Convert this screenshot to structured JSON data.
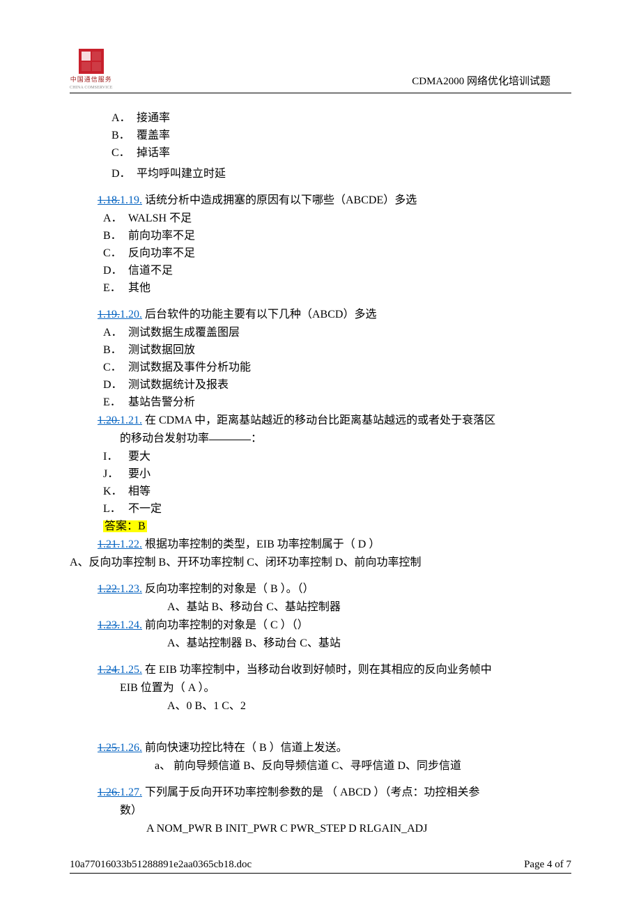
{
  "header": {
    "logo_cn": "中国通信服务",
    "logo_en": "CHINA COMSERVICE",
    "title": "CDMA2000 网络优化培训试题"
  },
  "intro_opts": {
    "a": "接通率",
    "b": "覆盖率",
    "c": "掉话率",
    "d": "平均呼叫建立时延"
  },
  "q119": {
    "num_old": "1.18.",
    "num_new": "1.19.",
    "text": " 话统分析中造成拥塞的原因有以下哪些（ABCDE）多选",
    "a": "WALSH 不足",
    "b": "前向功率不足",
    "c": "反向功率不足",
    "d": "信道不足",
    "e": "其他"
  },
  "q120": {
    "num_old": "1.19.",
    "num_new": "1.20.",
    "text": " 后台软件的功能主要有以下几种（ABCD）多选",
    "a": "测试数据生成覆盖图层",
    "b": "测试数据回放",
    "c": "测试数据及事件分析功能",
    "d": "测试数据统计及报表",
    "e": "基站告警分析"
  },
  "q121": {
    "num_old": "1.20.",
    "num_new": "1.21.",
    "text1": " 在 CDMA 中，距离基站越近的移动台比距离基站越远的或者处于衰落区",
    "text2": "的移动台发射功率",
    "i": "要大",
    "j": "要小",
    "k": "相等",
    "l": "不一定",
    "answer": "答案：B"
  },
  "q122": {
    "num_old": "1.21.",
    "num_new": "1.22.",
    "text": " 根据功率控制的类型，EIB 功率控制属于（ D ）",
    "opts": "A、反向功率控制 B、开环功率控制 C、闭环功率控制 D、前向功率控制"
  },
  "q123": {
    "num_old": "1.22.",
    "num_new": "1.23.",
    "text": " 反向功率控制的对象是（ B ）。（）",
    "opts": "A、基站 B、移动台 C、基站控制器"
  },
  "q124": {
    "num_old": "1.23.",
    "num_new": "1.24.",
    "text": " 前向功率控制的对象是（ C ）（）",
    "opts": "A、基站控制器 B、移动台 C、基站"
  },
  "q125": {
    "num_old": "1.24.",
    "num_new": "1.25.",
    "text": " 在 EIB 功率控制中，当移动台收到好帧时，则在其相应的反向业务帧中",
    "text2": "EIB 位置为（ A ）。",
    "opts": "A、0 B、1 C、2"
  },
  "q126": {
    "num_old": "1.25.",
    "num_new": "1.26.",
    "text": " 前向快速功控比特在（ B ）信道上发送。",
    "opts": "a、  前向导频信道 B、反向导频信道 C、寻呼信道 D、同步信道"
  },
  "q127": {
    "num_old": "1.26.",
    "num_new": "1.27.",
    "text": " 下列属于反向开环功率控制参数的是 （ ABCD  ）（考点：功控相关参",
    "text2": "数）",
    "opts": "A  NOM_PWR   B   INIT_PWR   C   PWR_STEP   D   RLGAIN_ADJ"
  },
  "footer": {
    "file": "10a77016033b51288891e2aa0365cb18.doc",
    "page": "Page 4 of 7"
  }
}
